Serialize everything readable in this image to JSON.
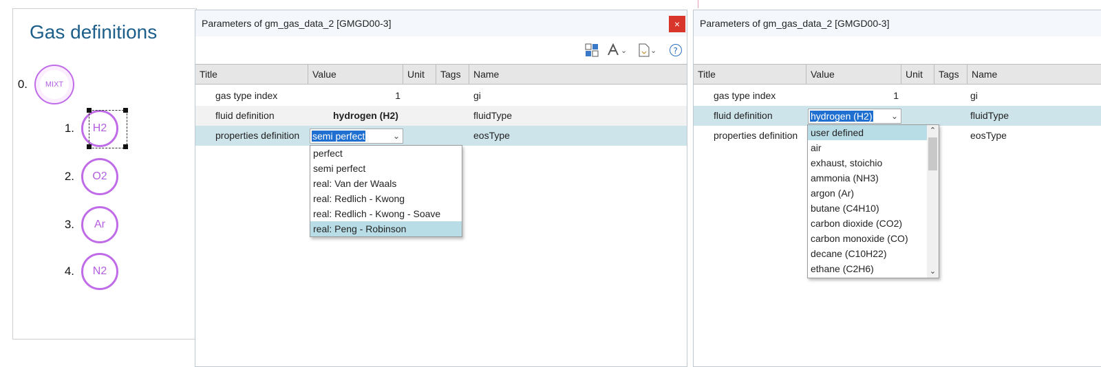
{
  "gas_panel": {
    "title": "Gas definitions",
    "items": [
      {
        "num": "0.",
        "label": "MIXT"
      },
      {
        "num": "1.",
        "label": "H2"
      },
      {
        "num": "2.",
        "label": "O2"
      },
      {
        "num": "3.",
        "label": "Ar"
      },
      {
        "num": "4.",
        "label": "N2"
      }
    ]
  },
  "dialog_left": {
    "title": "Parameters of gm_gas_data_2 [GMGD00-3]",
    "close_label": "×",
    "columns": [
      "Title",
      "Value",
      "Unit",
      "Tags",
      "Name"
    ],
    "rows": [
      {
        "title": "gas type index",
        "value": "1",
        "name": "gi"
      },
      {
        "title": "fluid definition",
        "value": "hydrogen (H2)",
        "name": "fluidType"
      },
      {
        "title": "properties definition",
        "value": "semi perfect",
        "name": "eosType"
      }
    ],
    "dropdown_options": [
      "perfect",
      "semi perfect",
      "real: Van der Waals",
      "real: Redlich - Kwong",
      "real: Redlich - Kwong - Soave",
      "real: Peng - Robinson"
    ]
  },
  "dialog_right": {
    "title": "Parameters of gm_gas_data_2 [GMGD00-3]",
    "columns": [
      "Title",
      "Value",
      "Unit",
      "Tags",
      "Name"
    ],
    "rows": [
      {
        "title": "gas type index",
        "value": "1",
        "name": "gi"
      },
      {
        "title": "fluid definition",
        "value": "hydrogen (H2)",
        "name": "fluidType"
      },
      {
        "title": "properties definition",
        "value": "",
        "name": "eosType"
      }
    ],
    "dropdown_options": [
      "user defined",
      "air",
      "exhaust, stoichio",
      "ammonia (NH3)",
      "argon (Ar)",
      "butane (C4H10)",
      "carbon dioxide (CO2)",
      "carbon monoxide (CO)",
      "decane (C10H22)",
      "ethane (C2H6)"
    ]
  },
  "colors": {
    "accent_selection": "#1e6fd0",
    "row_selected": "#cde4ea",
    "gas_circle": "#c06be8",
    "close_button": "#d9362b"
  },
  "icons": [
    "layout-icon",
    "font-icon",
    "export-icon",
    "help-icon",
    "chevron-down-icon",
    "close-icon"
  ]
}
